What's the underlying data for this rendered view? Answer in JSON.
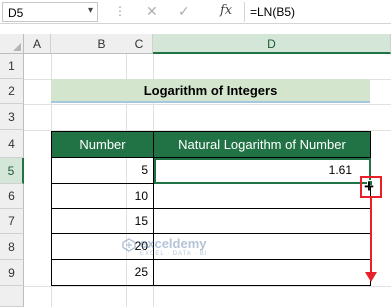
{
  "formula_bar": {
    "name_box": "D5",
    "name_caret": "▾",
    "more_icon": "⋮",
    "cancel_icon": "✕",
    "enter_icon": "✓",
    "fx_label": "fx",
    "formula": "=LN(B5)"
  },
  "columns": [
    "A",
    "B",
    "C",
    "D"
  ],
  "rows": [
    "1",
    "2",
    "3",
    "4",
    "5",
    "6",
    "7",
    "8",
    "9"
  ],
  "title": "Logarithm of Integers",
  "table": {
    "headers": [
      "Number",
      "Natural Logarithm of Number"
    ],
    "rows": [
      {
        "number": "5",
        "ln": "1.61"
      },
      {
        "number": "10",
        "ln": ""
      },
      {
        "number": "15",
        "ln": ""
      },
      {
        "number": "20",
        "ln": ""
      },
      {
        "number": "25",
        "ln": ""
      }
    ]
  },
  "fill_cursor_icon": "+",
  "watermark": {
    "name": "exceldemy",
    "tagline": "EXCEL · DATA · BI"
  },
  "colors": {
    "accent": "#217346",
    "title_fill": "#d3e5cd",
    "annotation": "#e8202a"
  }
}
